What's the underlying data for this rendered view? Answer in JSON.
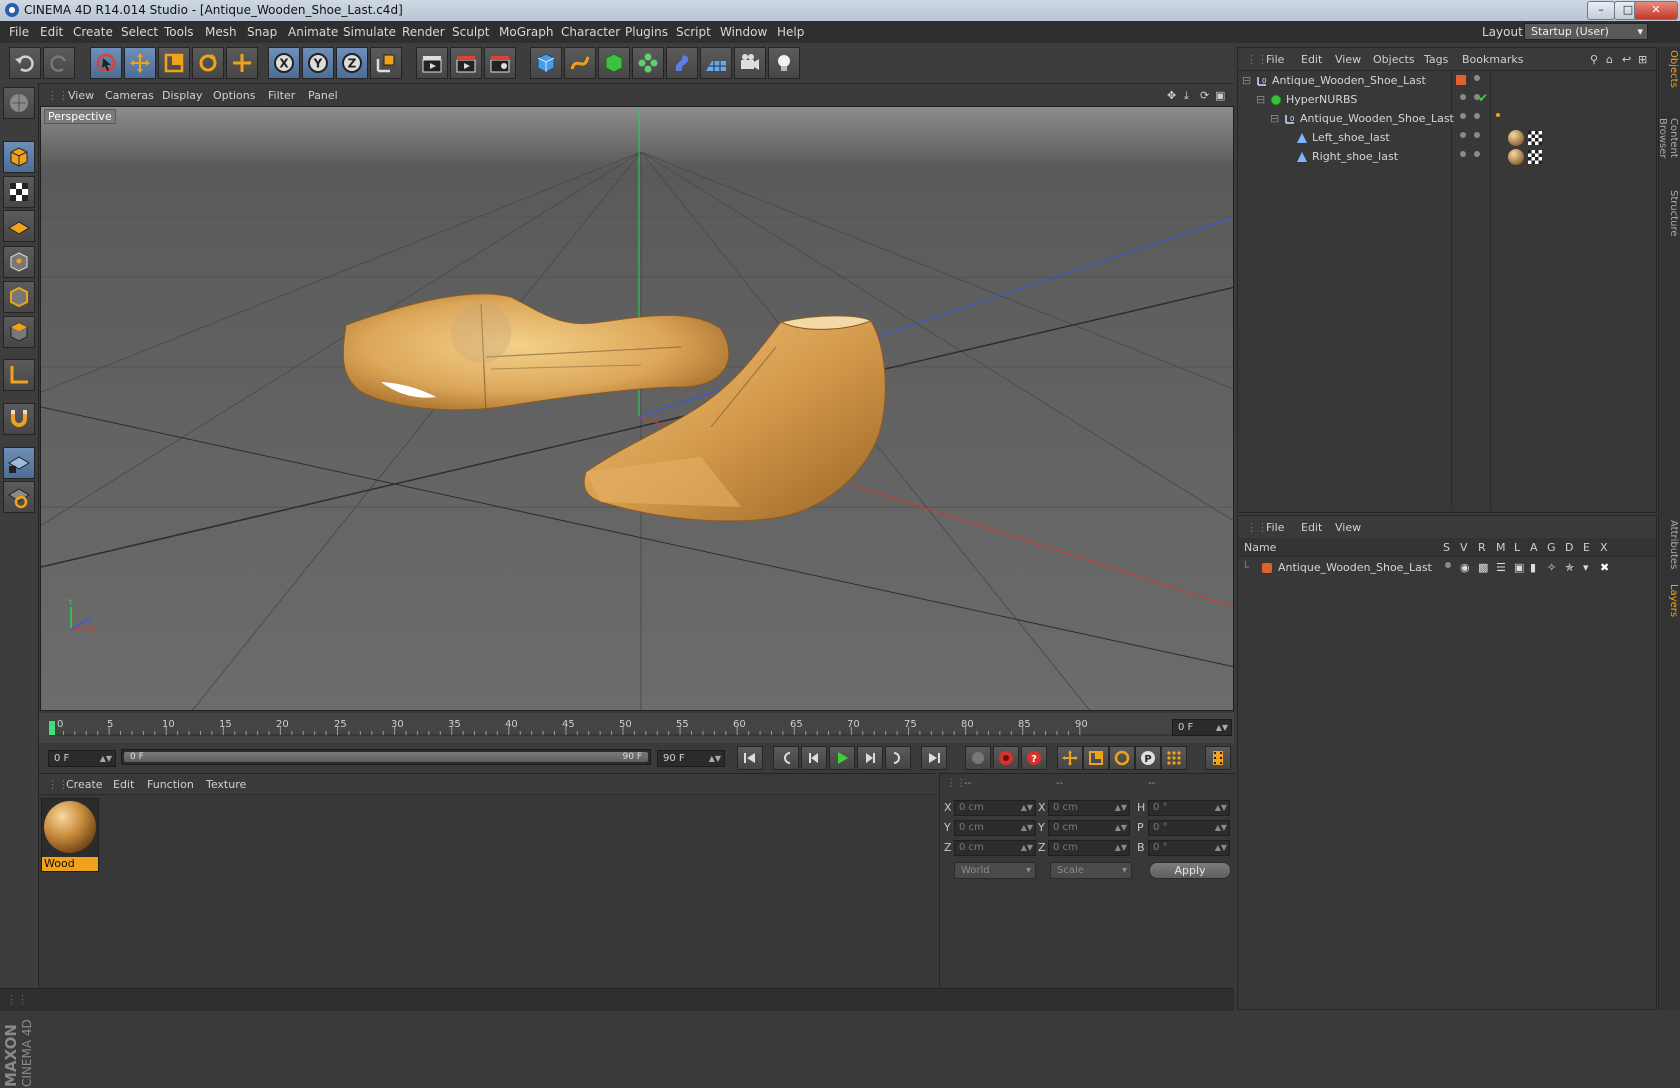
{
  "window": {
    "title": "CINEMA 4D R14.014 Studio - [Antique_Wooden_Shoe_Last.c4d]"
  },
  "menu": [
    "File",
    "Edit",
    "Create",
    "Select",
    "Tools",
    "Mesh",
    "Snap",
    "Animate",
    "Simulate",
    "Render",
    "Sculpt",
    "MoGraph",
    "Character",
    "Plugins",
    "Script",
    "Window",
    "Help"
  ],
  "layout": {
    "label": "Layout:",
    "value": "Startup (User)"
  },
  "viewport": {
    "menu": [
      "View",
      "Cameras",
      "Display",
      "Options",
      "Filter",
      "Panel"
    ],
    "camera_label": "Perspective"
  },
  "timeline": {
    "ticks": [
      "0",
      "5",
      "10",
      "15",
      "20",
      "25",
      "30",
      "35",
      "40",
      "45",
      "50",
      "55",
      "60",
      "65",
      "70",
      "75",
      "80",
      "85",
      "90"
    ],
    "current_frame": "0 F",
    "start_frame": "0 F",
    "range_start": "0 F",
    "range_end": "90 F",
    "end_frame": "90 F"
  },
  "material_manager": {
    "menu": [
      "Create",
      "Edit",
      "Function",
      "Texture"
    ],
    "materials": [
      {
        "name": "Wood"
      }
    ]
  },
  "coordinates": {
    "headers": [
      "--",
      "--",
      "--"
    ],
    "rows": [
      {
        "a1": "X",
        "v1": "0 cm",
        "a2": "X",
        "v2": "0 cm",
        "a3": "H",
        "v3": "0 °"
      },
      {
        "a1": "Y",
        "v1": "0 cm",
        "a2": "Y",
        "v2": "0 cm",
        "a3": "P",
        "v3": "0 °"
      },
      {
        "a1": "Z",
        "v1": "0 cm",
        "a2": "Z",
        "v2": "0 cm",
        "a3": "B",
        "v3": "0 °"
      }
    ],
    "space": "World",
    "mode": "Scale",
    "apply": "Apply"
  },
  "object_manager": {
    "menu": [
      "File",
      "Edit",
      "View",
      "Objects",
      "Tags",
      "Bookmarks"
    ],
    "objects": [
      {
        "name": "Antique_Wooden_Shoe_Last",
        "type": "null"
      },
      {
        "name": "HyperNURBS",
        "type": "hypernurbs"
      },
      {
        "name": "Antique_Wooden_Shoe_Last",
        "type": "null"
      },
      {
        "name": "Left_shoe_last",
        "type": "polygon"
      },
      {
        "name": "Right_shoe_last",
        "type": "polygon"
      }
    ]
  },
  "layer_manager": {
    "menu": [
      "File",
      "Edit",
      "View"
    ],
    "columns": [
      "Name",
      "S",
      "V",
      "R",
      "M",
      "L",
      "A",
      "G",
      "D",
      "E",
      "X"
    ],
    "layers": [
      {
        "name": "Antique_Wooden_Shoe_Last",
        "color": "#e0622a"
      }
    ]
  },
  "side_tabs": [
    "Objects",
    "Content Browser",
    "Structure",
    "Attributes",
    "Layers"
  ],
  "branding": {
    "maxon": "MAXON",
    "product": "CINEMA 4D"
  },
  "colors": {
    "accent": "#f0a21c",
    "axis_x": "#c0392b",
    "axis_y": "#27ae60",
    "axis_z": "#2f4fd0"
  }
}
